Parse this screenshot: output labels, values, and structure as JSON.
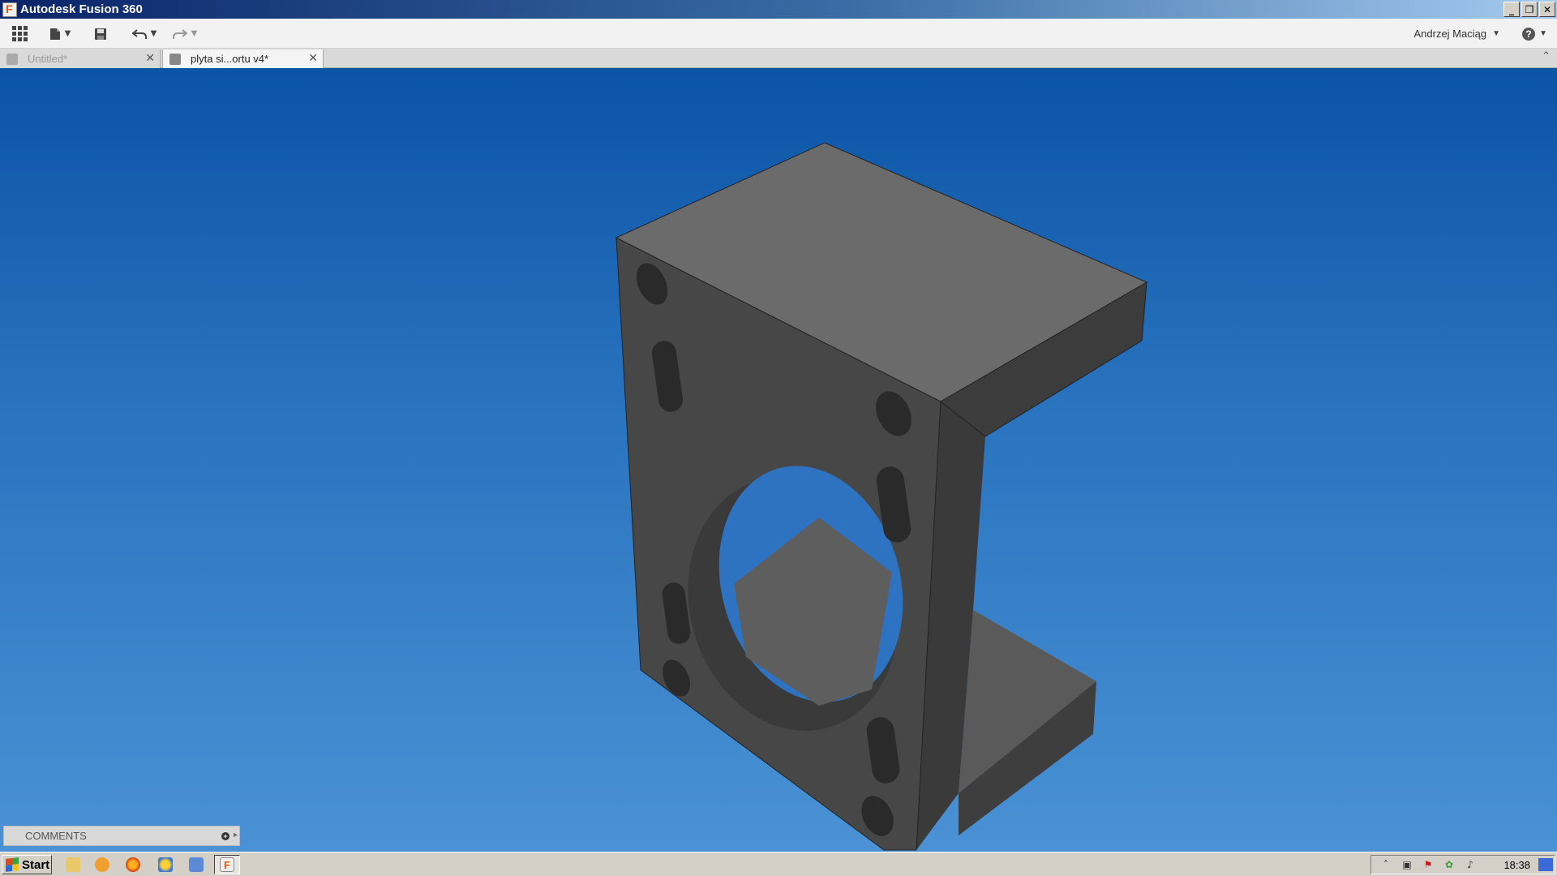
{
  "window": {
    "title": "Autodesk Fusion 360",
    "minimize": "_",
    "maximize": "❐",
    "close": "✕"
  },
  "toolbar": {
    "user_name": "Andrzej Maciąg",
    "help_label": "?",
    "icons": [
      "grid-icon",
      "file-icon",
      "save-icon",
      "undo-icon",
      "redo-icon"
    ]
  },
  "tabs": [
    {
      "label": "Untitled*",
      "active": false
    },
    {
      "label": "plyta si...ortu v4*",
      "active": true
    }
  ],
  "comments": {
    "label": "COMMENTS"
  },
  "taskbar": {
    "start_label": "Start",
    "clock": "18:38",
    "quick_launch": [
      "explorer-icon",
      "media-player-icon",
      "firefox-icon",
      "weather-icon",
      "desktop-icon",
      "fusion-icon"
    ]
  },
  "colors": {
    "viewport_top": "#0b54a6",
    "viewport_bottom": "#4a92d4",
    "model_face_top": "#6b6b6b",
    "model_face_front": "#474747",
    "model_face_side": "#3c3c3c"
  }
}
